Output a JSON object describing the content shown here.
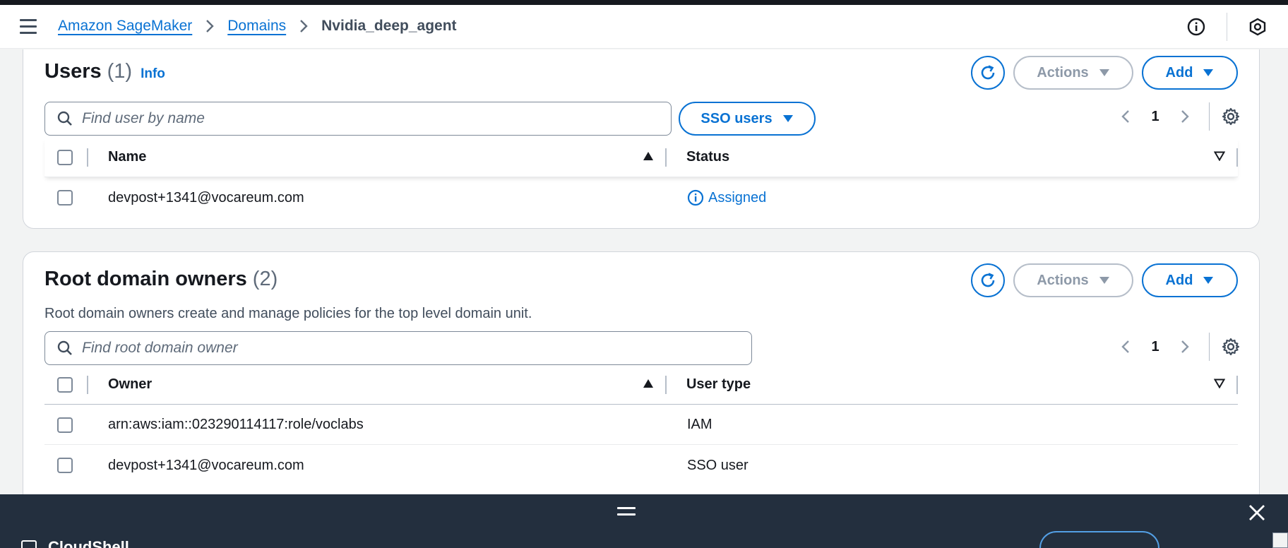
{
  "breadcrumb": {
    "items": [
      "Amazon SageMaker",
      "Domains"
    ],
    "current": "Nvidia_deep_agent"
  },
  "users_panel": {
    "title": "Users",
    "count": "(1)",
    "info_label": "Info",
    "actions_label": "Actions",
    "add_label": "Add",
    "search_placeholder": "Find user by name",
    "filter_label": "SSO users",
    "page": "1",
    "columns": {
      "name": "Name",
      "status": "Status"
    },
    "rows": [
      {
        "name": "devpost+1341@vocareum.com",
        "status": "Assigned"
      }
    ]
  },
  "root_owners_panel": {
    "title": "Root domain owners",
    "count": "(2)",
    "description": "Root domain owners create and manage policies for the top level domain unit.",
    "actions_label": "Actions",
    "add_label": "Add",
    "search_placeholder": "Find root domain owner",
    "page": "1",
    "columns": {
      "owner": "Owner",
      "user_type": "User type"
    },
    "rows": [
      {
        "owner": "arn:aws:iam::023290114117:role/voclabs",
        "user_type": "IAM"
      },
      {
        "owner": "devpost+1341@vocareum.com",
        "user_type": "SSO user"
      }
    ]
  },
  "cloudshell": {
    "title": "CloudShell"
  },
  "colors": {
    "link": "#0972d3",
    "text": "#16191f",
    "disabled": "#8d99a8",
    "cloudshell_bg": "#232f3e"
  },
  "icons": [
    "menu-icon",
    "chevron-right-icon",
    "info-circle-icon",
    "settings-hex-icon",
    "refresh-icon",
    "caret-down-icon",
    "search-icon",
    "chevron-left-icon",
    "gear-icon",
    "sort-ascending-icon",
    "sort-descending-outline-icon",
    "drag-handle-icon",
    "close-icon"
  ]
}
